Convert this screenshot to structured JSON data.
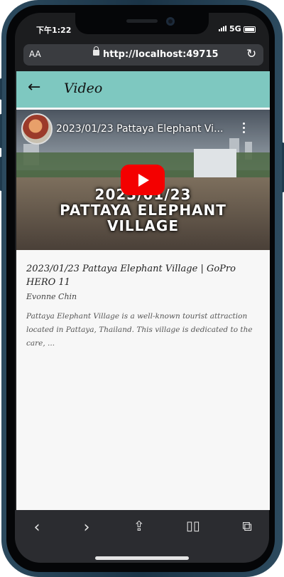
{
  "status": {
    "time": "下午1:22",
    "network": "5G"
  },
  "browser": {
    "text_size_label": "AA",
    "url": "http://localhost:49715"
  },
  "app": {
    "title": "Video",
    "back_icon": "arrow-left-icon"
  },
  "video": {
    "player_title": "2023/01/23 Pattaya Elephant Vi...",
    "overlay_title_line1": "2023/01/23",
    "overlay_title_line2": "PATTAYA ELEPHANT",
    "overlay_title_line3": "VILLAGE"
  },
  "details": {
    "title": "2023/01/23 Pattaya Elephant Village | GoPro HERO 11",
    "author": "Evonne Chin",
    "description": "Pattaya Elephant Village is a well-known tourist attraction located in Pattaya, Thailand. This village is dedicated to the care, ..."
  },
  "toolbar": {
    "icons": [
      "chevron-left-icon",
      "chevron-right-icon",
      "share-icon",
      "bookmarks-icon",
      "tabs-icon"
    ]
  },
  "colors": {
    "appbar": "#7ec8c0",
    "youtube_red": "#f40000"
  }
}
